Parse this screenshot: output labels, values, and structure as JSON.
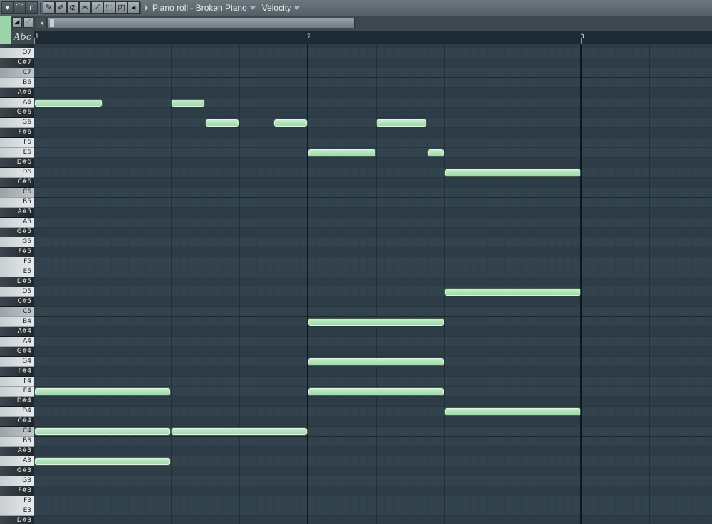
{
  "toolbar": {
    "menu_label": "Piano roll - Broken Piano",
    "event_label": "Velocity",
    "tools": [
      {
        "name": "menu-arrow-icon",
        "glyph": "▾"
      },
      {
        "name": "magnet-icon",
        "glyph": "⌒"
      },
      {
        "name": "snap-icon",
        "glyph": "∩"
      },
      {
        "name": "pencil-icon",
        "glyph": "✎"
      },
      {
        "name": "brush-icon",
        "glyph": "✐"
      },
      {
        "name": "delete-icon",
        "glyph": "⊘"
      },
      {
        "name": "mute-icon",
        "glyph": "✂"
      },
      {
        "name": "slice-icon",
        "glyph": "⟋"
      },
      {
        "name": "select-icon",
        "glyph": "⬚"
      },
      {
        "name": "zoom-icon",
        "glyph": "◰"
      },
      {
        "name": "playback-icon",
        "glyph": "◂"
      }
    ]
  },
  "subbar": {
    "tool_a_glyph": "◢",
    "tool_b_glyph": "／",
    "scroll_left_glyph": "◂"
  },
  "ruler": {
    "abc_label": "Abc",
    "bars": [
      "1",
      "2",
      "3"
    ]
  },
  "keyboard": {
    "labels": [
      "D#7",
      "D7",
      "C#7",
      "C7",
      "B6",
      "A#6",
      "A6",
      "G#6",
      "G6",
      "F#6",
      "F6",
      "E6",
      "D#6",
      "D6",
      "C#6",
      "C6",
      "B5",
      "A#5",
      "A5",
      "G#5",
      "G5",
      "F#5",
      "F5",
      "E5",
      "D#5",
      "D5",
      "C#5",
      "C5",
      "B4",
      "A#4",
      "A4",
      "G#4",
      "G4",
      "F#4",
      "F4",
      "E4",
      "D#4",
      "D4",
      "C#4",
      "C4",
      "B3",
      "A#3",
      "A3",
      "G#3",
      "G3",
      "F#3",
      "F3",
      "E3",
      "D#3"
    ]
  },
  "piano_roll": {
    "steps_per_bar": 16,
    "bars_visible": 5,
    "notes": [
      {
        "pitch": "A6",
        "start": 0,
        "length": 4
      },
      {
        "pitch": "A6",
        "start": 8,
        "length": 2
      },
      {
        "pitch": "G6",
        "start": 10,
        "length": 2
      },
      {
        "pitch": "G6",
        "start": 14,
        "length": 2
      },
      {
        "pitch": "G6",
        "start": 20,
        "length": 3
      },
      {
        "pitch": "E6",
        "start": 16,
        "length": 4
      },
      {
        "pitch": "E6",
        "start": 23,
        "length": 1
      },
      {
        "pitch": "D6",
        "start": 24,
        "length": 8
      },
      {
        "pitch": "D5",
        "start": 24,
        "length": 8
      },
      {
        "pitch": "B4",
        "start": 16,
        "length": 8
      },
      {
        "pitch": "G4",
        "start": 16,
        "length": 8
      },
      {
        "pitch": "E4",
        "start": 0,
        "length": 8
      },
      {
        "pitch": "E4",
        "start": 16,
        "length": 8
      },
      {
        "pitch": "D4",
        "start": 24,
        "length": 8
      },
      {
        "pitch": "C4",
        "start": 0,
        "length": 8
      },
      {
        "pitch": "C4",
        "start": 8,
        "length": 8
      },
      {
        "pitch": "A3",
        "start": 0,
        "length": 8
      }
    ],
    "colors": {
      "note": "#a8deb3",
      "note_border": "#dff6e2"
    }
  }
}
